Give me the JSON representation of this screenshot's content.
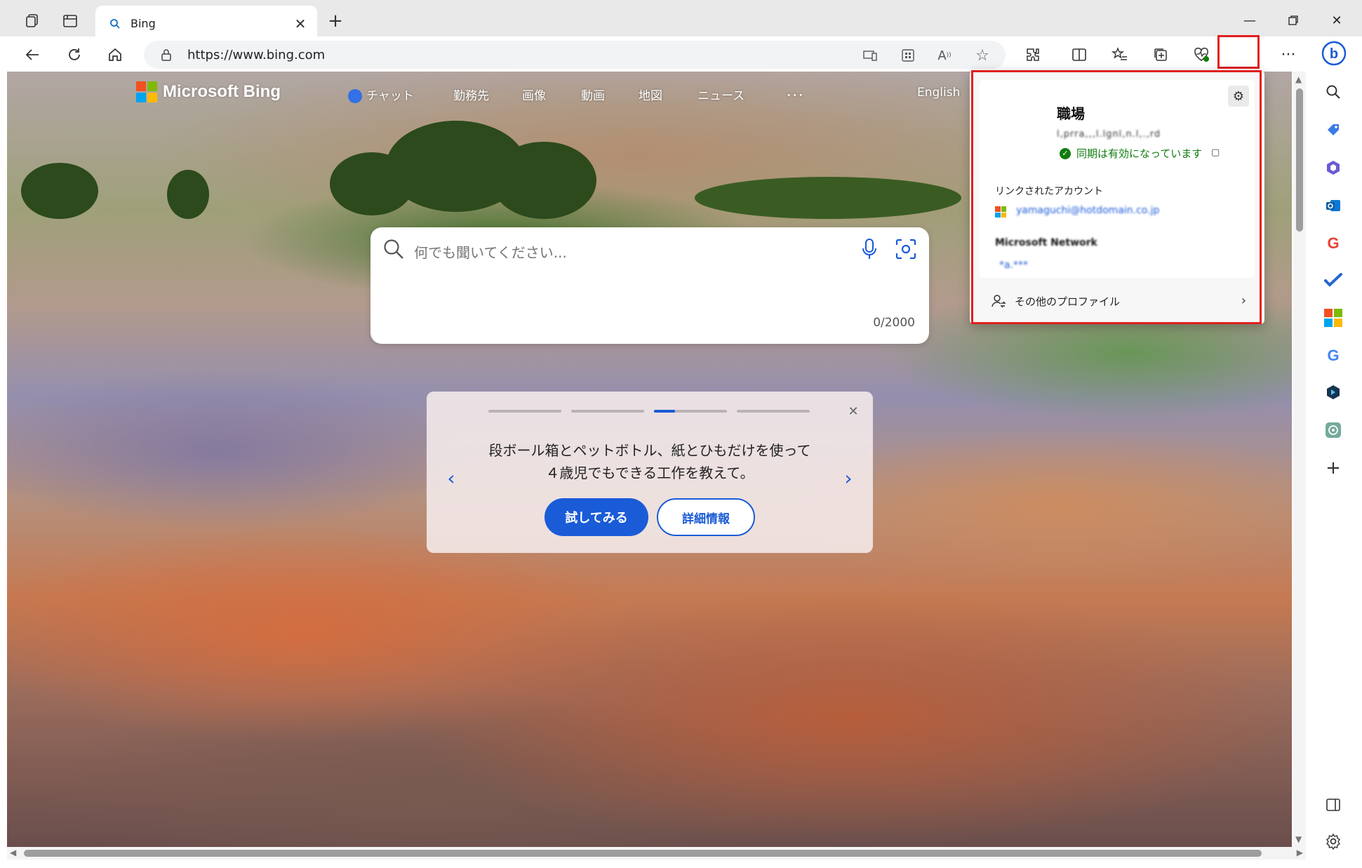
{
  "browser": {
    "tab_title": "Bing",
    "url": "https://www.bing.com"
  },
  "bing": {
    "brand": "Microsoft Bing",
    "nav": [
      "チャット",
      "勤務先",
      "画像",
      "動画",
      "地図",
      "ニュース",
      "･･･"
    ],
    "language_link": "English",
    "search_placeholder": "何でも聞いてください...",
    "char_count": "0/2000",
    "card": {
      "message": "段ボール箱とペットボトル、紙とひもだけを使って４歳児でもできる工作を教えて。",
      "try_label": "試してみる",
      "more_label": "詳細情報",
      "active_page": 3,
      "page_count": 4
    }
  },
  "profile_popup": {
    "profile_name": "職場",
    "email_blurred": "l,prra,,,l.lgnl,n.l,.,rd",
    "sync_status": "同期は有効になっています",
    "linked_accounts_heading": "リンクされたアカウント",
    "linked_email_blurred": "yamaguchi@hotdomain.co.jp",
    "ms_network_blurred": "Microsoft Network",
    "ms_network_sub_blurred": "*a.***",
    "other_profiles": "その他のプロファイル"
  },
  "colors": {
    "accent": "#1a5bd7",
    "highlight": "#e0201f",
    "sync_green": "#107c10",
    "ms_red": "#f25022",
    "ms_green": "#7fba00",
    "ms_blue": "#00a4ef",
    "ms_yellow": "#ffb900"
  }
}
